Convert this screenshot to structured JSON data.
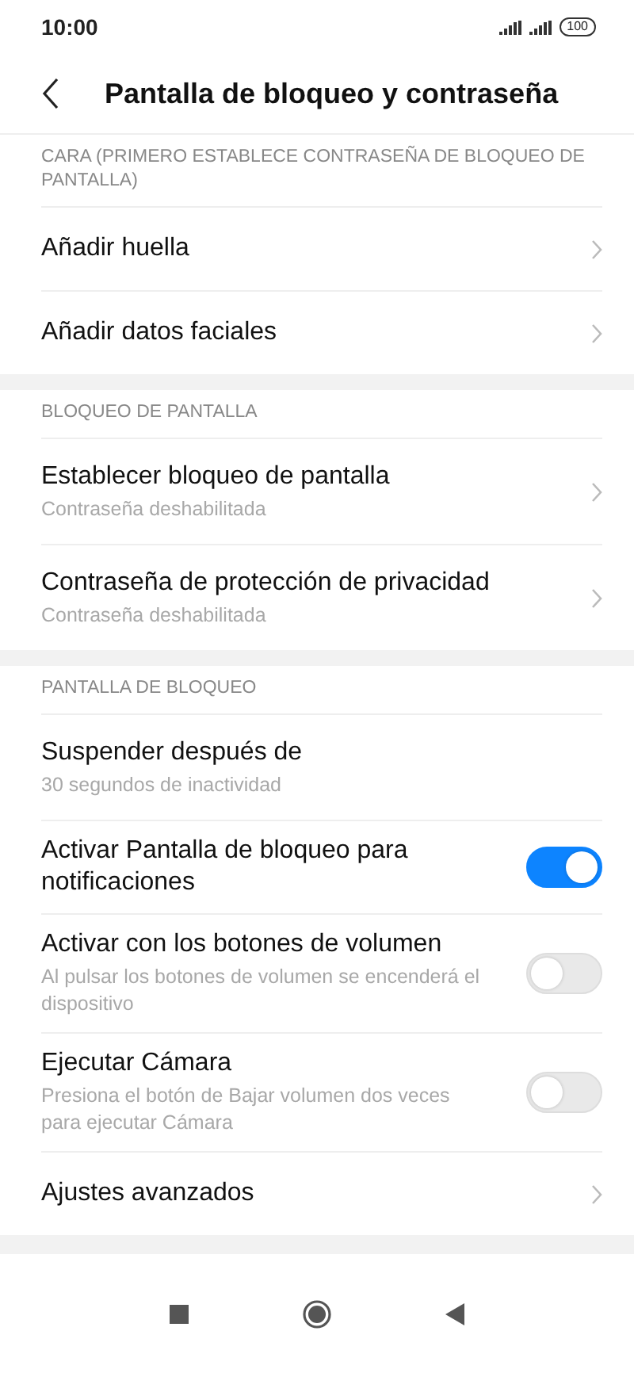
{
  "status_bar": {
    "time": "10:00",
    "battery": "100"
  },
  "header": {
    "title": "Pantalla de bloqueo y contraseña"
  },
  "sections": [
    {
      "title": "CARA (PRIMERO ESTABLECE CONTRASEÑA DE BLOQUEO DE PANTALLA)",
      "items": [
        {
          "kind": "link",
          "title": "Añadir huella"
        },
        {
          "kind": "link",
          "title": "Añadir datos faciales"
        }
      ]
    },
    {
      "title": "BLOQUEO DE PANTALLA",
      "items": [
        {
          "kind": "link",
          "title": "Establecer bloqueo de pantalla",
          "subtitle": "Contraseña deshabilitada"
        },
        {
          "kind": "link",
          "title": "Contraseña de protección de privacidad",
          "subtitle": "Contraseña deshabilitada"
        }
      ]
    },
    {
      "title": "PANTALLA DE BLOQUEO",
      "items": [
        {
          "kind": "plain",
          "title": "Suspender después de",
          "subtitle": "30 segundos de inactividad"
        },
        {
          "kind": "toggle",
          "title": "Activar Pantalla de bloqueo para notificaciones",
          "on": true
        },
        {
          "kind": "toggle",
          "title": "Activar con los botones de volumen",
          "subtitle": "Al pulsar los botones de volumen se encenderá el dispositivo",
          "on": false
        },
        {
          "kind": "toggle",
          "title": "Ejecutar Cámara",
          "subtitle": "Presiona el botón de Bajar volumen dos veces para ejecutar Cámara",
          "on": false
        },
        {
          "kind": "link",
          "title": "Ajustes avanzados"
        }
      ]
    }
  ]
}
